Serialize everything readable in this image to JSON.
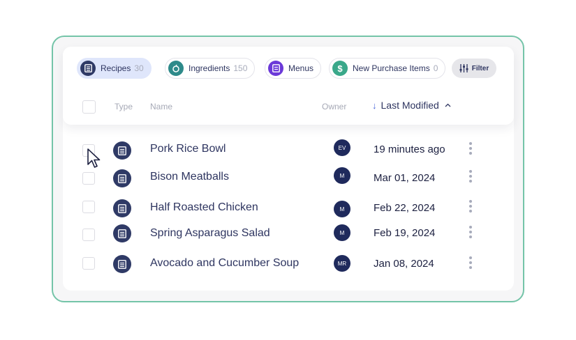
{
  "chips": [
    {
      "label": "Recipes",
      "count": "30",
      "icon": "recipe-book-icon",
      "color": "#2f3a66"
    },
    {
      "label": "Ingredients",
      "count": "150",
      "icon": "leaf-icon",
      "color": "#2e8a8a"
    },
    {
      "label": "Menus",
      "count": "",
      "icon": "menu-icon",
      "color": "#6b39d8"
    },
    {
      "label": "New Purchase Items",
      "count": "0",
      "icon": "dollar-icon",
      "color": "#3aa88a"
    }
  ],
  "filter_label": "Filter",
  "columns": {
    "type": "Type",
    "name": "Name",
    "owner": "Owner",
    "last_modified": "Last Modified"
  },
  "rows": [
    {
      "name": "Pork Rice Bowl",
      "owner": "EV",
      "modified": "19 minutes ago"
    },
    {
      "name": "Bison Meatballs",
      "owner": "M",
      "modified": "Mar 01, 2024"
    },
    {
      "name": "Half Roasted Chicken",
      "owner": "M",
      "modified": "Feb 22, 2024"
    },
    {
      "name": "Spring Asparagus Salad",
      "owner": "M",
      "modified": "Feb 19, 2024"
    },
    {
      "name": "Avocado and Cucumber Soup",
      "owner": "MR",
      "modified": "Jan 08, 2024"
    }
  ]
}
